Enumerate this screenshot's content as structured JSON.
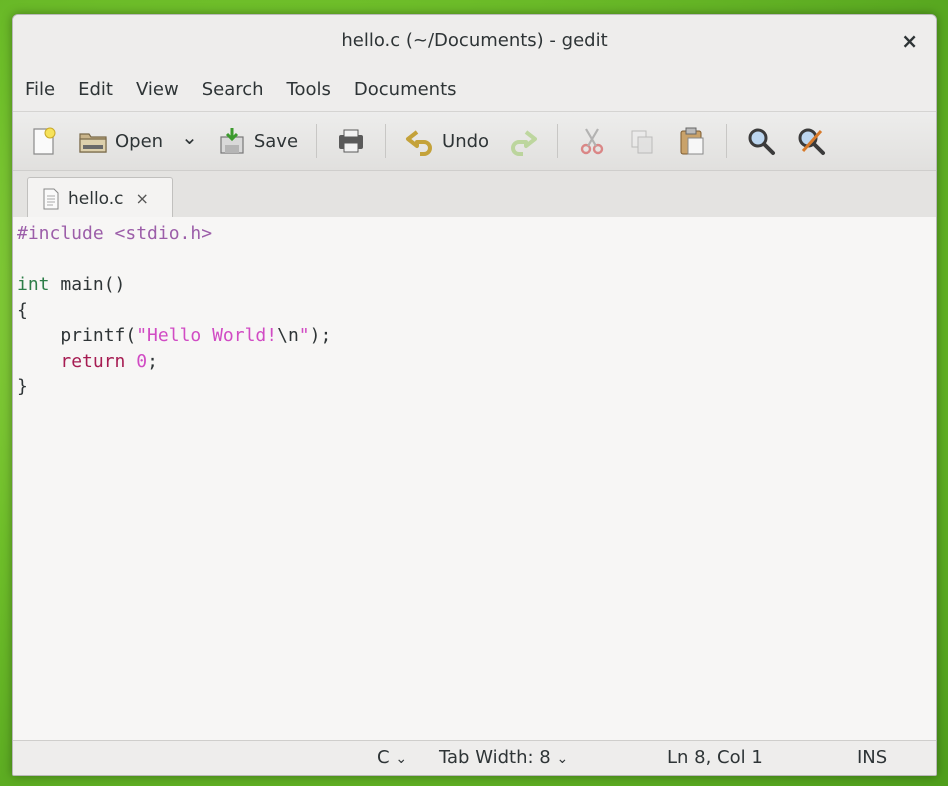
{
  "window": {
    "title": "hello.c (~/Documents) - gedit",
    "close_glyph": "×"
  },
  "menubar": {
    "items": [
      "File",
      "Edit",
      "View",
      "Search",
      "Tools",
      "Documents"
    ]
  },
  "toolbar": {
    "new_icon": "new-document-icon",
    "open_label": "Open",
    "open_dropdown_glyph": "⌄",
    "save_label": "Save",
    "print_icon": "printer-icon",
    "undo_label": "Undo",
    "redo_icon": "redo-icon",
    "cut_icon": "cut-icon",
    "copy_icon": "copy-icon",
    "paste_icon": "paste-icon",
    "find_icon": "search-icon",
    "replace_icon": "find-replace-icon"
  },
  "tabs": [
    {
      "label": "hello.c",
      "close_glyph": "×",
      "active": true
    }
  ],
  "editor": {
    "lines": [
      [
        {
          "t": "#include <stdio.h>",
          "c": "kw-pre"
        }
      ],
      [],
      [
        {
          "t": "int",
          "c": "kw-type"
        },
        {
          "t": " main()"
        }
      ],
      [
        {
          "t": "{"
        }
      ],
      [
        {
          "t": "    printf("
        },
        {
          "t": "\"Hello World!",
          "c": "kw-str"
        },
        {
          "t": "\\n"
        },
        {
          "t": "\"",
          "c": "kw-str"
        },
        {
          "t": ");"
        }
      ],
      [
        {
          "t": "    "
        },
        {
          "t": "return",
          "c": "kw-ret"
        },
        {
          "t": " "
        },
        {
          "t": "0",
          "c": "kw-num"
        },
        {
          "t": ";"
        }
      ],
      [
        {
          "t": "}"
        }
      ]
    ]
  },
  "statusbar": {
    "language": "C",
    "tab_width": "Tab Width: 8",
    "position": "Ln 8, Col 1",
    "mode": "INS"
  },
  "colors": {
    "preprocessor": "#9c5ea9",
    "string": "#d14bc4",
    "type": "#2d7d48",
    "keyword": "#a61c52"
  }
}
